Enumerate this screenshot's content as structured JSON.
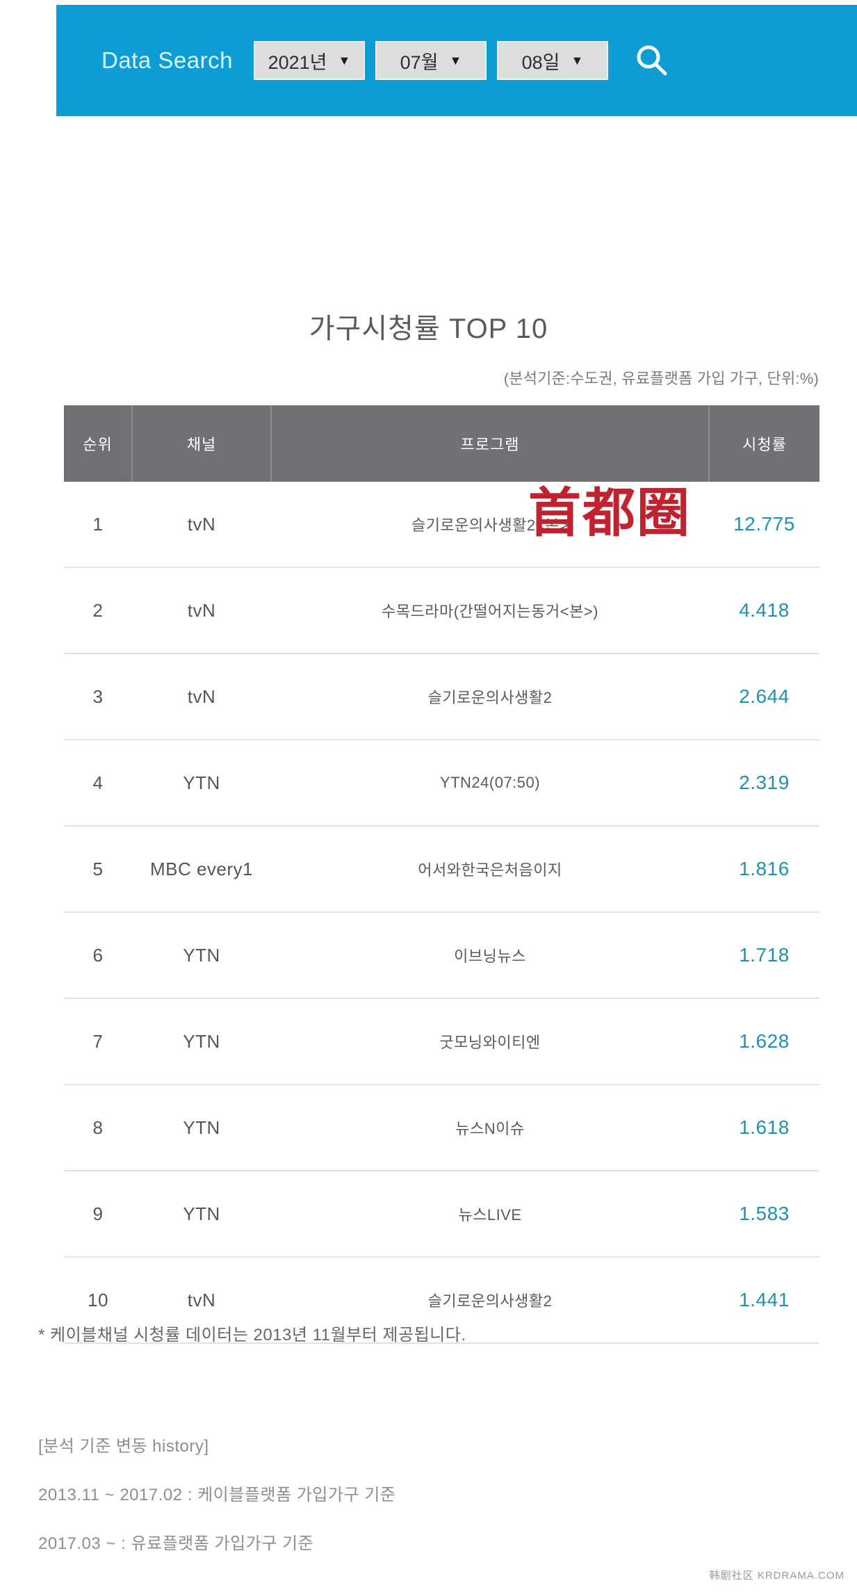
{
  "search": {
    "label": "Data Search",
    "year": {
      "value": "2021년",
      "caret": "▼"
    },
    "month": {
      "value": "07월",
      "caret": "▼"
    },
    "day": {
      "value": "08일",
      "caret": "▼"
    },
    "search_icon": "search-icon"
  },
  "header": {
    "title": "가구시청률 TOP 10",
    "subtitle": "(분석기준:수도권, 유료플랫폼 가입 가구, 단위:%)"
  },
  "table": {
    "columns": [
      "순위",
      "채널",
      "프로그램",
      "시청률"
    ],
    "rows": [
      {
        "rank": "1",
        "channel": "tvN",
        "program": "슬기로운의사생활2<본>",
        "rating": "12.775"
      },
      {
        "rank": "2",
        "channel": "tvN",
        "program": "수목드라마(간떨어지는동거<본>)",
        "rating": "4.418"
      },
      {
        "rank": "3",
        "channel": "tvN",
        "program": "슬기로운의사생활2",
        "rating": "2.644"
      },
      {
        "rank": "4",
        "channel": "YTN",
        "program": "YTN24(07:50)",
        "rating": "2.319"
      },
      {
        "rank": "5",
        "channel": "MBC every1",
        "program": "어서와한국은처음이지",
        "rating": "1.816"
      },
      {
        "rank": "6",
        "channel": "YTN",
        "program": "이브닝뉴스",
        "rating": "1.718"
      },
      {
        "rank": "7",
        "channel": "YTN",
        "program": "굿모닝와이티엔",
        "rating": "1.628"
      },
      {
        "rank": "8",
        "channel": "YTN",
        "program": "뉴스N이슈",
        "rating": "1.618"
      },
      {
        "rank": "9",
        "channel": "YTN",
        "program": "뉴스LIVE",
        "rating": "1.583"
      },
      {
        "rank": "10",
        "channel": "tvN",
        "program": "슬기로운의사생활2",
        "rating": "1.441"
      }
    ]
  },
  "stamp": {
    "text": "首都圈",
    "color": "#c0232f"
  },
  "footnote": "* 케이블채널 시청률 데이터는 2013년 11월부터 제공됩니다.",
  "history": {
    "heading": "[분석 기준 변동 history]",
    "line1": "2013.11 ~ 2017.02 : 케이블플랫폼 가입가구 기준",
    "line2": "2017.03 ~ : 유료플랫폼 가입가구 기준"
  },
  "watermark": "韩剧社区 KRDRAMA.COM",
  "colors": {
    "header_blue": "#0d9dd4",
    "table_header_gray": "#6f7174",
    "rating_teal": "#2390ad",
    "stamp_red": "#c0232f"
  },
  "chart_data": {
    "type": "table",
    "title": "가구시청률 TOP 10",
    "subtitle": "(분석기준:수도권, 유료플랫폼 가입 가구, 단위:%)",
    "columns": [
      "순위",
      "채널",
      "프로그램",
      "시청률"
    ],
    "categories": [
      "슬기로운의사생활2<본>",
      "수목드라마(간떨어지는동거<본>)",
      "슬기로운의사생활2",
      "YTN24(07:50)",
      "어서와한국은처음이지",
      "이브닝뉴스",
      "굿모닝와이티엔",
      "뉴스N이슈",
      "뉴스LIVE",
      "슬기로운의사생활2"
    ],
    "values": [
      12.775,
      4.418,
      2.644,
      2.319,
      1.816,
      1.718,
      1.628,
      1.618,
      1.583,
      1.441
    ],
    "ylabel": "시청률 (%)",
    "date": "2021년 07월 08일"
  }
}
